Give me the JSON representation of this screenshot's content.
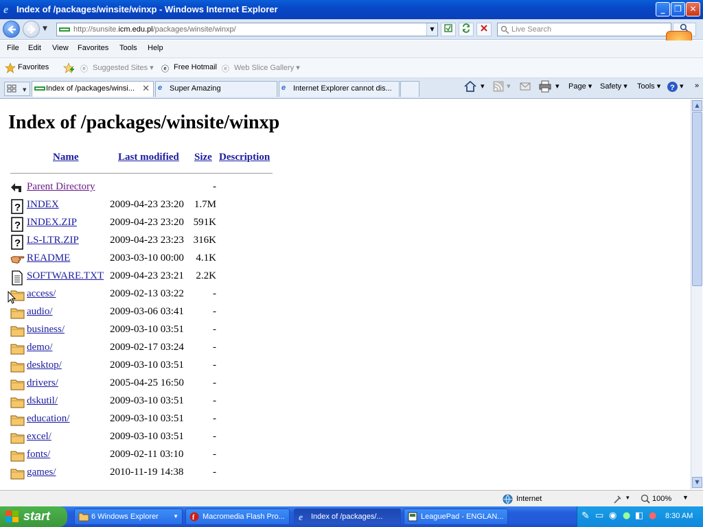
{
  "window": {
    "title": "Index of /packages/winsite/winxp - Windows Internet Explorer",
    "minimize": "_",
    "restore": "❐",
    "close": "✕"
  },
  "address": {
    "url_prefix": "http://sunsite.",
    "url_host": "icm.edu.pl",
    "url_path": "/packages/winsite/winxp/",
    "search_placeholder": "Live Search"
  },
  "menu": [
    "File",
    "Edit",
    "View",
    "Favorites",
    "Tools",
    "Help"
  ],
  "favorites_bar": {
    "favorites": "Favorites",
    "items": [
      {
        "label": "Suggested Sites ▾",
        "dim": true
      },
      {
        "label": "Free Hotmail",
        "dim": false
      },
      {
        "label": "Web Slice Gallery ▾",
        "dim": true
      }
    ]
  },
  "tabs": [
    {
      "label": "Index of /packages/winsi...",
      "active": true
    },
    {
      "label": "Super Amazing",
      "active": false
    },
    {
      "label": "Internet Explorer cannot dis...",
      "active": false
    }
  ],
  "commands": [
    "Page ▾",
    "Safety ▾",
    "Tools ▾"
  ],
  "page": {
    "heading": "Index of /packages/winsite/winxp",
    "columns": {
      "name": "Name",
      "modified": "Last modified",
      "size": "Size",
      "description": "Description"
    },
    "rows": [
      {
        "icon": "parent-icon",
        "name": "Parent Directory",
        "date": "",
        "size": "-",
        "visited": true
      },
      {
        "icon": "unknown-file-icon",
        "name": "INDEX",
        "date": "2009-04-23 23:20",
        "size": "1.7M"
      },
      {
        "icon": "unknown-file-icon",
        "name": "INDEX.ZIP",
        "date": "2009-04-23 23:20",
        "size": "591K"
      },
      {
        "icon": "unknown-file-icon",
        "name": "LS-LTR.ZIP",
        "date": "2009-04-23 23:23",
        "size": "316K"
      },
      {
        "icon": "readme-hand-icon",
        "name": "README",
        "date": "2003-03-10 00:00",
        "size": "4.1K"
      },
      {
        "icon": "text-file-icon",
        "name": "SOFTWARE.TXT",
        "date": "2009-04-23 23:21",
        "size": "2.2K"
      },
      {
        "icon": "folder-icon",
        "name": "access/",
        "date": "2009-02-13 03:22",
        "size": "-"
      },
      {
        "icon": "folder-icon",
        "name": "audio/",
        "date": "2009-03-06 03:41",
        "size": "-"
      },
      {
        "icon": "folder-icon",
        "name": "business/",
        "date": "2009-03-10 03:51",
        "size": "-"
      },
      {
        "icon": "folder-icon",
        "name": "demo/",
        "date": "2009-02-17 03:24",
        "size": "-"
      },
      {
        "icon": "folder-icon",
        "name": "desktop/",
        "date": "2009-03-10 03:51",
        "size": "-"
      },
      {
        "icon": "folder-icon",
        "name": "drivers/",
        "date": "2005-04-25 16:50",
        "size": "-"
      },
      {
        "icon": "folder-icon",
        "name": "dskutil/",
        "date": "2009-03-10 03:51",
        "size": "-"
      },
      {
        "icon": "folder-icon",
        "name": "education/",
        "date": "2009-03-10 03:51",
        "size": "-"
      },
      {
        "icon": "folder-icon",
        "name": "excel/",
        "date": "2009-03-10 03:51",
        "size": "-"
      },
      {
        "icon": "folder-icon",
        "name": "fonts/",
        "date": "2009-02-11 03:10",
        "size": "-"
      },
      {
        "icon": "folder-icon",
        "name": "games/",
        "date": "2010-11-19 14:38",
        "size": "-"
      }
    ]
  },
  "status": {
    "zone": "Internet",
    "zoom": "100%"
  },
  "taskbar": {
    "start": "start",
    "tasks": [
      {
        "label": "6 Windows Explorer",
        "icon": "folder-icon",
        "active": false
      },
      {
        "label": "Macromedia Flash Pro...",
        "icon": "flash-icon",
        "active": false
      },
      {
        "label": "Index of /packages/...",
        "icon": "ie-icon",
        "active": true
      },
      {
        "label": "LeaguePad - ENGLAN...",
        "icon": "app-icon",
        "active": false
      }
    ],
    "clock": "8:30 AM"
  },
  "colors": {
    "link": "#1a1aa0",
    "visited_link": "#6a1b8a",
    "titlebar": "#0a5fd8",
    "taskbar": "#245edb",
    "start_button": "#3a973a"
  }
}
